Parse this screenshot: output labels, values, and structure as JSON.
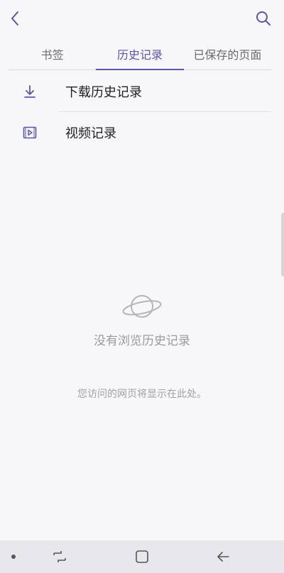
{
  "header": {
    "back_icon": "chevron-left-icon",
    "search_icon": "search-icon"
  },
  "tabs": [
    {
      "label": "书签",
      "active": false
    },
    {
      "label": "历史记录",
      "active": true
    },
    {
      "label": "已保存的页面",
      "active": false
    }
  ],
  "list": [
    {
      "label": "下载历史记录",
      "icon": "download-icon"
    },
    {
      "label": "视频记录",
      "icon": "video-icon"
    }
  ],
  "empty_state": {
    "icon": "planet-icon",
    "title": "没有浏览历史记录",
    "description": "您访问的网页将显示在此处。"
  },
  "navbar": {
    "recents_icon": "recents-icon",
    "home_icon": "home-icon",
    "back_icon": "back-arrow-icon"
  },
  "colors": {
    "accent": "#5b55a6",
    "background": "#f7f7f9",
    "text_primary": "#1f1f22",
    "text_muted": "#9b9b9f"
  }
}
